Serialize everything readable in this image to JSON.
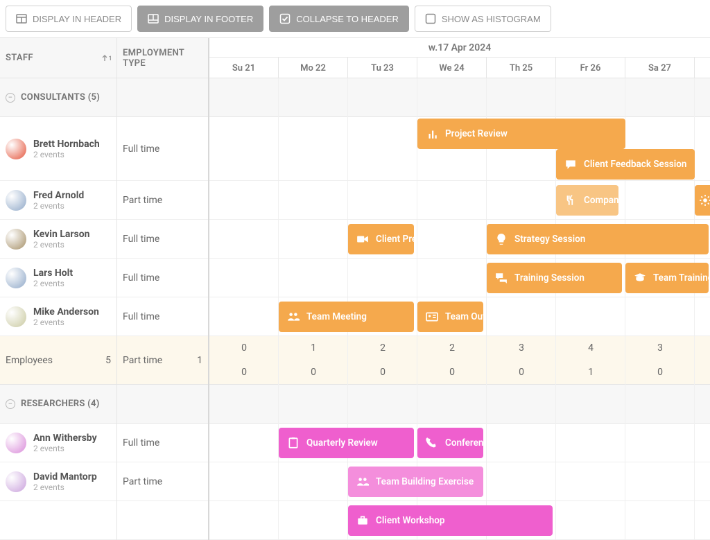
{
  "toolbar": {
    "display_header": "DISPLAY IN HEADER",
    "display_footer": "DISPLAY IN FOOTER",
    "collapse_header": "COLLAPSE TO HEADER",
    "show_histogram": "SHOW AS HISTOGRAM"
  },
  "columns": {
    "staff": "STAFF",
    "employment": "EMPLOYMENT TYPE",
    "sort_index": "1"
  },
  "timeline": {
    "week_title": "w.17 Apr 2024",
    "days": [
      "Su 21",
      "Mo 22",
      "Tu 23",
      "We 24",
      "Th 25",
      "Fr 26",
      "Sa 27"
    ]
  },
  "groups": {
    "consultants": {
      "label": "CONSULTANTS (5)",
      "summary_left": {
        "employees_label": "Employees",
        "employees_count": "5",
        "parttime_label": "Part time",
        "parttime_count": "1"
      },
      "summary_counts": {
        "row1": [
          "0",
          "1",
          "2",
          "2",
          "3",
          "4",
          "3"
        ],
        "row2": [
          "0",
          "0",
          "0",
          "0",
          "0",
          "1",
          "0"
        ]
      },
      "rows": [
        {
          "name": "Brett Hornbach",
          "sub": "2 events",
          "emp": "Full time"
        },
        {
          "name": "Fred Arnold",
          "sub": "2 events",
          "emp": "Part time"
        },
        {
          "name": "Kevin Larson",
          "sub": "2 events",
          "emp": "Full time"
        },
        {
          "name": "Lars Holt",
          "sub": "2 events",
          "emp": "Full time"
        },
        {
          "name": "Mike Anderson",
          "sub": "2 events",
          "emp": "Full time"
        }
      ]
    },
    "researchers": {
      "label": "RESEARCHERS (4)",
      "rows": [
        {
          "name": "Ann Withersby",
          "sub": "2 events",
          "emp": "Full time"
        },
        {
          "name": "David Mantorp",
          "sub": "2 events",
          "emp": "Part time"
        }
      ]
    }
  },
  "events": {
    "brett1": "Project Review",
    "brett2": "Client Feedback Session",
    "fred1": "Company Retreat",
    "kevin1": "Client Presentation",
    "kevin2": "Strategy Session",
    "lars1": "Training Session",
    "lars2": "Team Training",
    "mike1": "Team Meeting",
    "mike2": "Team Outing",
    "ann1": "Quarterly Review",
    "ann2": "Conference",
    "david1": "Team Building Exercise",
    "next1": "Client Workshop"
  }
}
